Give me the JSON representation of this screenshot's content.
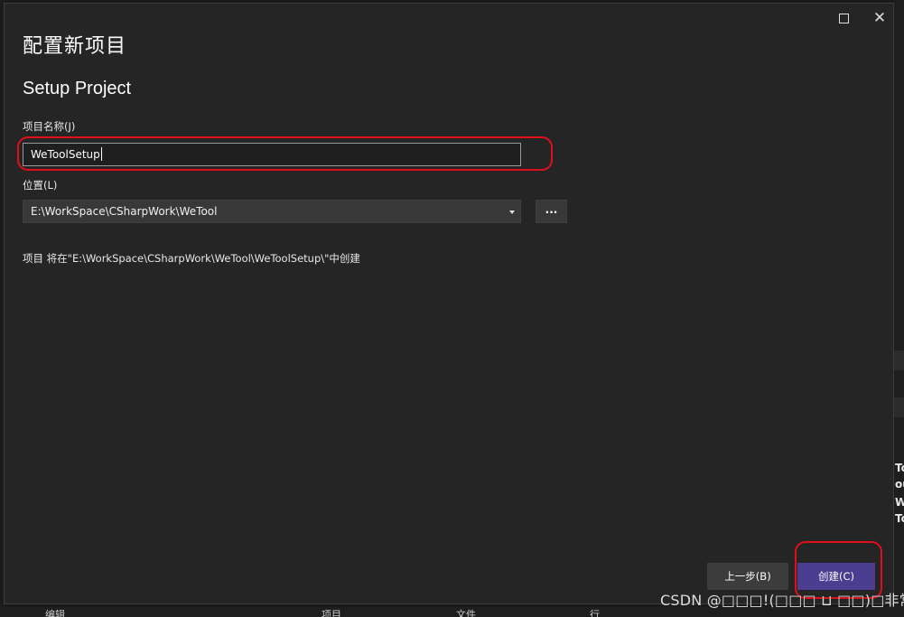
{
  "window": {
    "maximize_icon": "maximize-icon",
    "close_icon": "close-icon"
  },
  "dialog": {
    "title": "配置新项目",
    "template_name": "Setup Project"
  },
  "form": {
    "project_name_label": "项目名称(J)",
    "project_name_value": "WeToolSetup",
    "location_label": "位置(L)",
    "location_value": "E:\\WorkSpace\\CSharpWork\\WeTool",
    "browse_label": "...",
    "info_text": "项目 将在\"E:\\WorkSpace\\CSharpWork\\WeTool\\WeToolSetup\\\"中创建"
  },
  "buttons": {
    "back_label": "上一步(B)",
    "create_label": "创建(C)"
  },
  "background": {
    "right_fragments": [
      "To",
      "ou",
      "Wo",
      "To"
    ],
    "bottom_fragments": [
      "编辑",
      "项目",
      "文件",
      "行"
    ]
  },
  "watermark": "CSDN @□□□!(□□□ ⊔ □□)□非常暴躁",
  "colors": {
    "dialog_bg": "#252526",
    "accent_button": "#4b3d8f",
    "annotation_red": "#e0101a"
  }
}
